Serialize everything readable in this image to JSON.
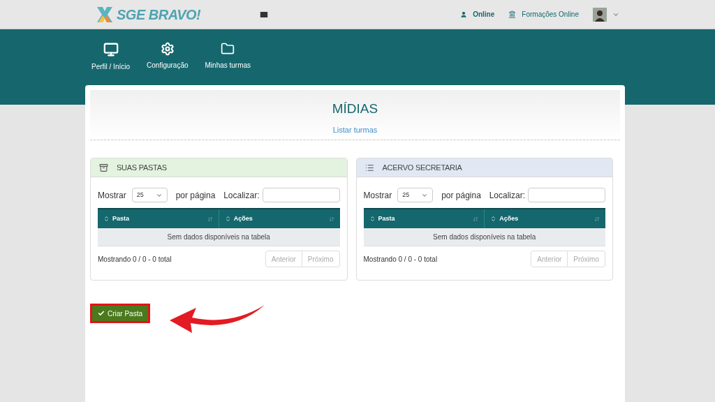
{
  "topbar": {
    "logo": "SGE BRAVO!",
    "status": "Online",
    "link": "Formações Online"
  },
  "nav": [
    {
      "kind": "monitor",
      "label": "Perfil / Início"
    },
    {
      "kind": "gear",
      "label": "Configuração"
    },
    {
      "kind": "folder",
      "label": "Minhas turmas"
    }
  ],
  "page": {
    "title": "MÍDIAS",
    "link": "Listar turmas"
  },
  "panels": [
    {
      "kind": "archive",
      "title": "SUAS PASTAS",
      "color": "#e3f3df",
      "show_label": "Mostrar",
      "page_size": "25",
      "per_page": "por página",
      "search_label": "Localizar:",
      "columns": [
        "Pasta",
        "Ações"
      ],
      "empty": "Sem dados disponíveis na tabela",
      "info": "Mostrando 0 / 0 - 0 total",
      "buttons": [
        {
          "label": "Anterior",
          "disabled": true
        },
        {
          "label": "Próximo",
          "disabled": true
        }
      ]
    },
    {
      "kind": "list",
      "title": "ACERVO SECRETARIA",
      "color": "#e1e8f3",
      "show_label": "Mostrar",
      "page_size": "25",
      "per_page": "por página",
      "search_label": "Localizar:",
      "columns": [
        "Pasta",
        "Ações"
      ],
      "empty": "Sem dados disponíveis na tabela",
      "info": "Mostrando 0 / 0 - 0 total",
      "buttons": [
        {
          "label": "Anterior",
          "disabled": true
        },
        {
          "label": "Próximo",
          "disabled": true
        }
      ]
    }
  ],
  "create_button": {
    "label": "Criar Pasta",
    "highlighted": true
  }
}
